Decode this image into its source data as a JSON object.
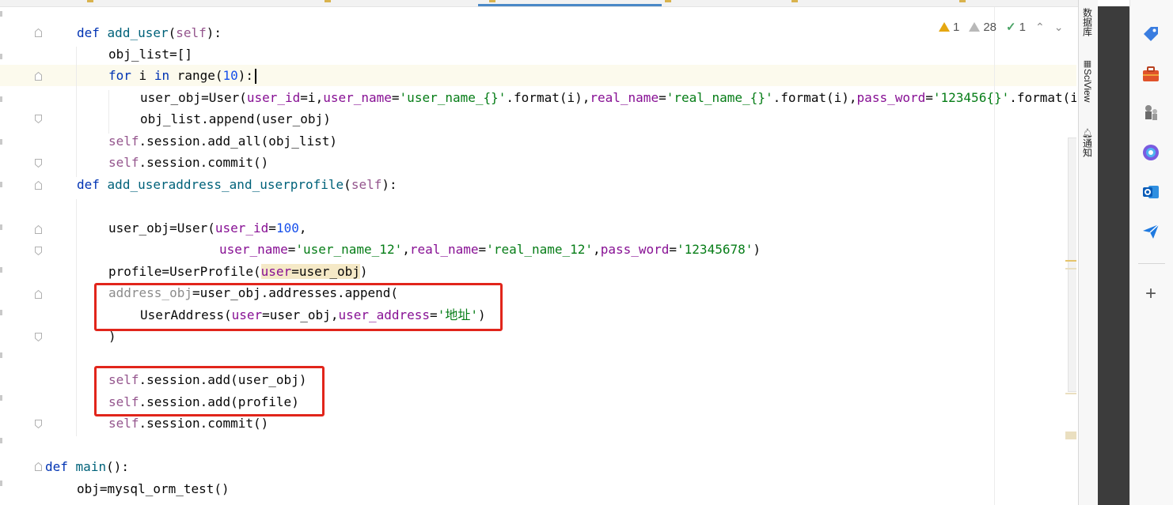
{
  "inspections": {
    "warnings": "1",
    "weak_warnings": "28",
    "typos": "1"
  },
  "tool_windows": {
    "database": "数据库",
    "sciview": "SciView",
    "notifications": "通知"
  },
  "colors": {
    "keyword": "#0033b3",
    "function": "#00627a",
    "self": "#94558d",
    "number": "#1750eb",
    "string": "#067d17",
    "parameter": "#871094",
    "highlight_box": "#e1251b"
  },
  "code": {
    "l1": {
      "kw": "def",
      "name": "add_user",
      "p1": "(",
      "self": "self",
      "p2": "):"
    },
    "l2": {
      "text": "obj_list=[]"
    },
    "l3": {
      "kw1": "for",
      "mid1": " i ",
      "kw2": "in",
      "mid2": " ",
      "fn": "range",
      "p1": "(",
      "num": "10",
      "p2": "):"
    },
    "l4": {
      "a": "user_obj=User(",
      "k1": "user_id",
      "b": "=i,",
      "k2": "user_name",
      "c": "=",
      "s1": "'user_name_{}'",
      "d": ".format(i),",
      "k3": "real_name",
      "e": "=",
      "s2": "'real_name_{}'",
      "f": ".format(i),",
      "k4": "pass_word",
      "g": "=",
      "s3": "'123456{}'",
      "h": ".format(i))"
    },
    "l5": {
      "text": "obj_list.append(user_obj)"
    },
    "l6": {
      "self": "self",
      "rest": ".session.add_all(obj_list)"
    },
    "l7": {
      "self": "self",
      "rest": ".session.commit()"
    },
    "l8": {
      "kw": "def",
      "name": "add_useraddress_and_userprofile",
      "p1": "(",
      "self": "self",
      "p2": "):"
    },
    "l10": {
      "a": "user_obj=User(",
      "k1": "user_id",
      "b": "=",
      "num": "100",
      "c": ","
    },
    "l11": {
      "k1": "user_name",
      "a": "=",
      "s1": "'user_name_12'",
      "b": ",",
      "k2": "real_name",
      "c": "=",
      "s2": "'real_name_12'",
      "d": ",",
      "k3": "pass_word",
      "e": "=",
      "s3": "'12345678'",
      "f": ")"
    },
    "l12": {
      "a": "profile=UserProfile(",
      "k1": "user",
      "b": "=user_obj",
      "c": ")"
    },
    "l13": {
      "var": "address_obj",
      "rest": "=user_obj.addresses.append("
    },
    "l14": {
      "a": "UserAddress(",
      "k1": "user",
      "b": "=user_obj,",
      "k2": "user_address",
      "c": "=",
      "s1": "'地址'",
      "d": ")"
    },
    "l15": {
      "text": ")"
    },
    "l17": {
      "self": "self",
      "rest": ".session.add(user_obj)"
    },
    "l18": {
      "self": "self",
      "rest": ".session.add(profile)"
    },
    "l19": {
      "self": "self",
      "rest": ".session.commit()"
    },
    "l21": {
      "kw": "def",
      "sp": " ",
      "name": "main",
      "rest": "():"
    },
    "l22": {
      "text": "obj=mysql_orm_test()"
    }
  }
}
